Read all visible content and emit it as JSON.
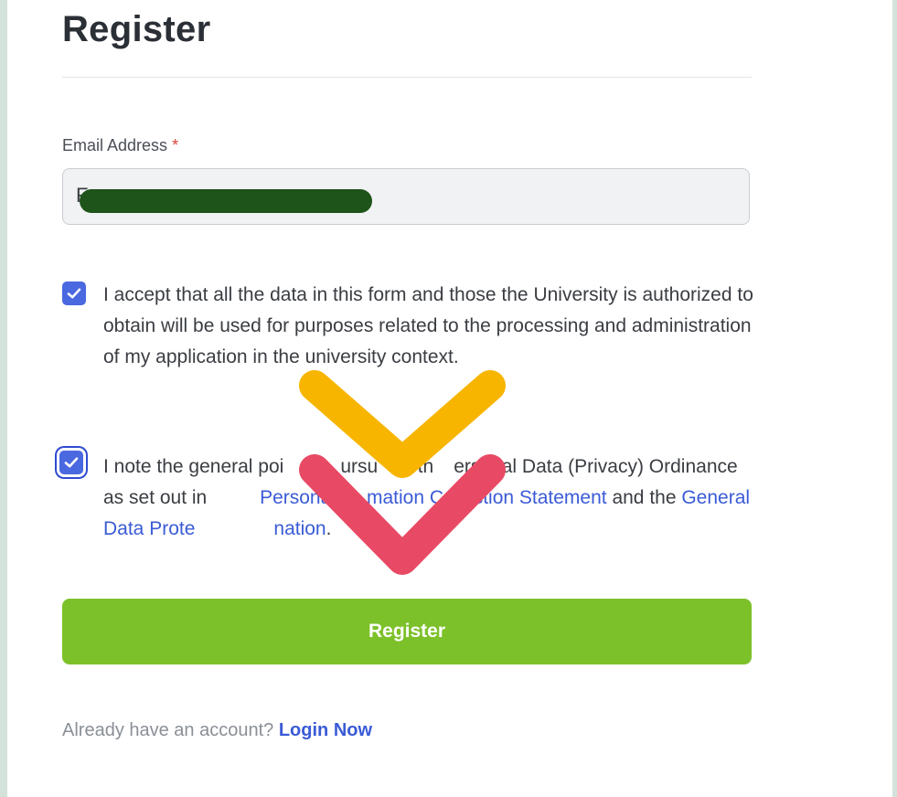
{
  "form": {
    "title": "Register",
    "email": {
      "label": "Email Address",
      "required_mark": "*",
      "value": "F"
    },
    "consents": [
      {
        "checked": true,
        "text": "I accept that all the data in this form and those the University is authorized to obtain will be used for purposes related to the processing and administration of my application in the university context."
      },
      {
        "checked": true,
        "text_before": "I note the general poi",
        "text_mid1": "ursu",
        "text_mid2": "o th",
        "text_mid3": "ersonal Data (Privacy) Ordinance as set out in ",
        "link1": "Personal",
        "link1_tail": "mation Collection Statement",
        "text_and": " and the ",
        "link2": "General Data Prote",
        "link2_tail": "nation",
        "text_end": "."
      }
    ],
    "submit_label": "Register",
    "footer": {
      "prompt": "Already have an account?",
      "login_label": "Login Now"
    }
  },
  "colors": {
    "primary_button": "#7dc12a",
    "checkbox": "#4a68e0",
    "link": "#3a5bd6",
    "annotation_arrow_yellow": "#f7b500",
    "annotation_arrow_red": "#e84a65",
    "redaction": "#1e5319"
  },
  "icons": [
    "check-icon",
    "annotation-arrow-down-icon"
  ]
}
